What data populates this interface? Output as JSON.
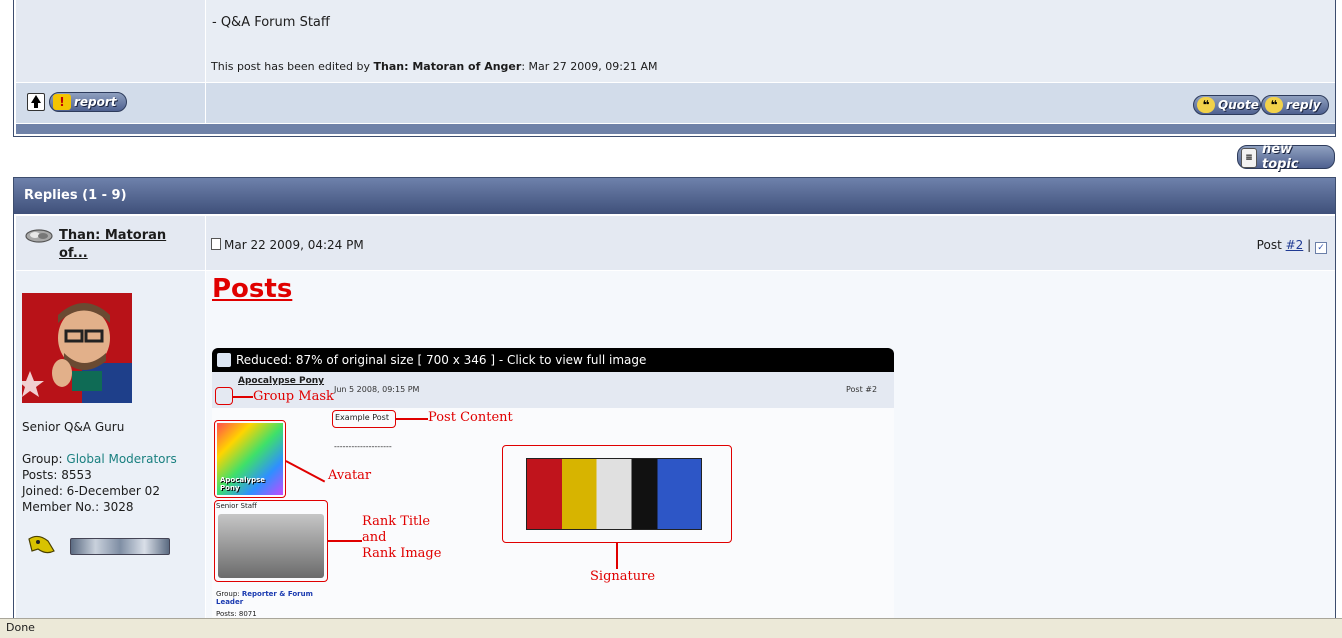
{
  "top_post": {
    "signature_line": "- Q&A Forum Staff",
    "edit_prefix": "This post has been edited by ",
    "edit_user": "Than: Matoran of Anger",
    "edit_suffix": ": Mar 27 2009, 09:21 AM"
  },
  "buttons": {
    "report": "report",
    "quote": "Quote",
    "reply": "reply",
    "new_topic": "new topic"
  },
  "replies": {
    "header": "Replies (1 - 9)",
    "post": {
      "author": "Than: Matoran of...",
      "date": "Mar 22 2009, 04:24 PM",
      "post_label": "Post ",
      "post_number": "#2",
      "separator": "|",
      "rank_title": "Senior Q&A Guru",
      "group_label": "Group: ",
      "group_value": "Global Moderators",
      "posts": "Posts: 8553",
      "joined": "Joined: 6-December 02",
      "member_no": "Member No.: 3028",
      "title": "Posts",
      "image_caption": "Reduced: 87% of original size [ 700 x 346 ] - Click to view full image"
    }
  },
  "embedded_image": {
    "user": "Apocalypse Pony",
    "date": "Jun 5 2008, 09:15 PM",
    "post_label": "Post #2",
    "example_post": "Example Post",
    "dashes": "--------------------",
    "rank": "Senior Staff",
    "group_label": "Group: ",
    "group_value": "Reporter & Forum Leader",
    "posts": "Posts: 8071",
    "avatar_text": "Apocalypse Pony",
    "annotations": {
      "group_mask": "Group Mask",
      "post_content": "Post Content",
      "avatar": "Avatar",
      "rank_title": "Rank Title",
      "and": "and",
      "rank_image": "Rank Image",
      "signature": "Signature"
    }
  },
  "status_bar": "Done"
}
